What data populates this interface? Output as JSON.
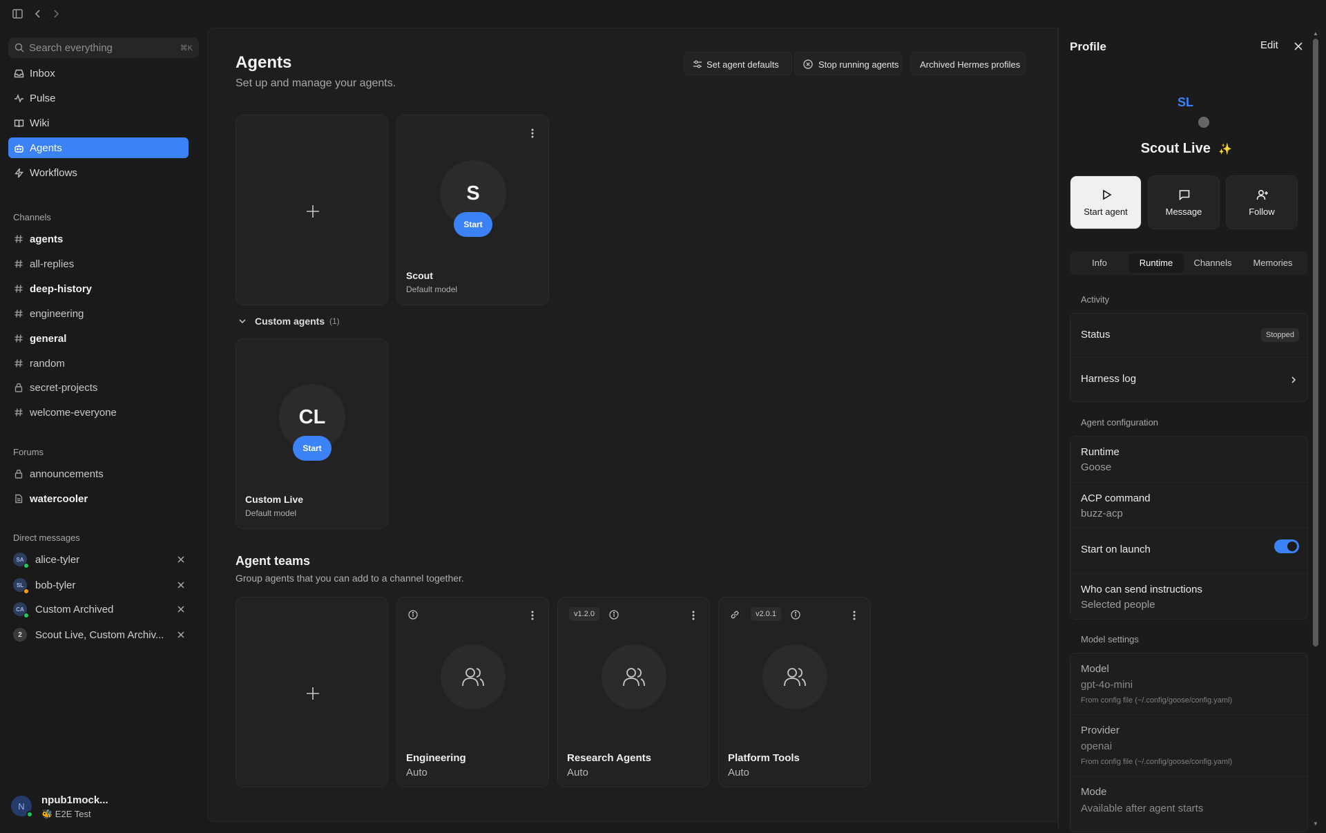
{
  "sidebar": {
    "search": {
      "placeholder": "Search everything",
      "shortcut": "⌘K"
    },
    "nav": [
      {
        "label": "Inbox",
        "icon": "inbox-icon"
      },
      {
        "label": "Pulse",
        "icon": "activity-icon"
      },
      {
        "label": "Wiki",
        "icon": "book-icon"
      },
      {
        "label": "Agents",
        "icon": "bot-icon",
        "active": true
      },
      {
        "label": "Workflows",
        "icon": "zap-icon"
      }
    ],
    "channels_title": "Channels",
    "channels": [
      "agents",
      "all-replies",
      "deep-history",
      "engineering",
      "general",
      "random",
      "secret-projects",
      "welcome-everyone"
    ],
    "forums_title": "Forums",
    "forums": [
      "announcements",
      "watercooler"
    ],
    "dm_title": "Direct messages",
    "dms": [
      {
        "initials": "SA",
        "label": "alice-tyler",
        "status_color": "#22c55e"
      },
      {
        "initials": "SL",
        "label": "bob-tyler",
        "status_color": "#f59e0b"
      },
      {
        "initials": "CA",
        "label": "Custom Archived",
        "status_color": "#22c55e"
      },
      {
        "initials": "2",
        "label": "Scout Live, Custom Archiv..."
      }
    ],
    "user": {
      "initial": "N",
      "name": "npub1mock...",
      "status": "🐝 E2E Test"
    }
  },
  "main": {
    "title": "Agents",
    "subtitle": "Set up and manage your agents.",
    "actions": {
      "defaults": "Set agent defaults",
      "stop": "Stop running agents",
      "archived": "Archived Hermes profiles"
    },
    "agents": [
      {
        "initials": "S",
        "start": "Start",
        "name": "Scout",
        "model": "Default model"
      }
    ],
    "custom_header": {
      "label": "Custom agents",
      "count": "(1)"
    },
    "custom_agents": [
      {
        "initials": "CL",
        "start": "Start",
        "name": "Custom Live",
        "model": "Default model"
      }
    ],
    "teams_title": "Agent teams",
    "teams_subtitle": "Group agents that you can add to a channel together.",
    "teams": [
      {
        "name": "Engineering",
        "model": "Auto",
        "version": ""
      },
      {
        "name": "Research Agents",
        "model": "Auto",
        "version": "v1.2.0"
      },
      {
        "name": "Platform Tools",
        "model": "Auto",
        "version": "v2.0.1"
      }
    ]
  },
  "panel": {
    "title": "Profile",
    "edit": "Edit",
    "initials": "SL",
    "name": "Scout Live",
    "name_icon": "✨",
    "actions": {
      "start": "Start agent",
      "message": "Message",
      "follow": "Follow"
    },
    "tabs": [
      "Info",
      "Runtime",
      "Channels",
      "Memories"
    ],
    "active_tab": "Runtime",
    "activity_title": "Activity",
    "status": {
      "label": "Status",
      "value": "Stopped"
    },
    "harness_log": "Harness log",
    "config_title": "Agent configuration",
    "runtime": {
      "label": "Runtime",
      "value": "Goose"
    },
    "acp": {
      "label": "ACP command",
      "value": "buzz-acp"
    },
    "start_on_launch": {
      "label": "Start on launch",
      "on": true
    },
    "who_can_send": {
      "label": "Who can send instructions",
      "value": "Selected people"
    },
    "model_settings_title": "Model settings",
    "model": {
      "label": "Model",
      "value": "gpt-4o-mini",
      "note": "From config file (~/.config/goose/config.yaml)"
    },
    "provider": {
      "label": "Provider",
      "value": "openai",
      "note": "From config file (~/.config/goose/config.yaml)"
    },
    "mode": {
      "label": "Mode",
      "value": "Available after agent starts"
    }
  },
  "colors": {
    "accent": "#3b82f6",
    "background": "#1a1a1a",
    "online": "#22c55e",
    "away": "#f59e0b"
  }
}
